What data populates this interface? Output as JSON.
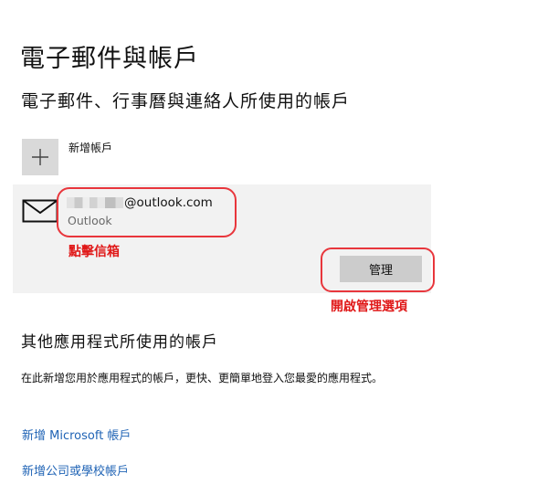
{
  "page": {
    "title": "電子郵件與帳戶",
    "section_title": "電子郵件、行事曆與連絡人所使用的帳戶"
  },
  "add_account": {
    "label": "新增帳戶",
    "icon": "plus-icon"
  },
  "account": {
    "email_visible": "@outlook.com",
    "provider": "Outlook",
    "icon": "mail-envelope-icon",
    "manage_label": "管理"
  },
  "annotations": {
    "mailbox_note": "點擊信箱",
    "manage_note": "開啟管理選項",
    "color": "#e8363c"
  },
  "other_apps": {
    "title": "其他應用程式所使用的帳戶",
    "description": "在此新增您用於應用程式的帳戶，更快、更簡單地登入您最愛的應用程式。",
    "links": {
      "microsoft": "新增 Microsoft 帳戶",
      "work_school": "新增公司或學校帳戶"
    }
  },
  "colors": {
    "link": "#1f63b5",
    "tile": "#d9d9d9",
    "panel": "#f2f2f2",
    "button": "#cccccc"
  }
}
